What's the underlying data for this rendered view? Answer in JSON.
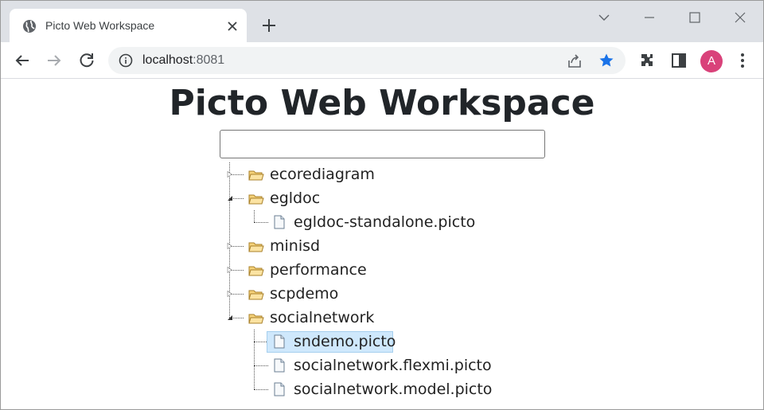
{
  "browser": {
    "tab_title": "Picto Web Workspace",
    "url_host": "localhost",
    "url_port": ":8081",
    "avatar_letter": "A"
  },
  "page": {
    "title": "Picto Web Workspace",
    "search_value": ""
  },
  "tree": [
    {
      "label": "ecorediagram",
      "kind": "folder",
      "expanded": false
    },
    {
      "label": "egldoc",
      "kind": "folder",
      "expanded": true
    },
    {
      "label": "egldoc-standalone.picto",
      "kind": "file",
      "parent": "egldoc"
    },
    {
      "label": "minisd",
      "kind": "folder",
      "expanded": false
    },
    {
      "label": "performance",
      "kind": "folder",
      "expanded": false
    },
    {
      "label": "scpdemo",
      "kind": "folder",
      "expanded": false
    },
    {
      "label": "socialnetwork",
      "kind": "folder",
      "expanded": true
    },
    {
      "label": "sndemo.picto",
      "kind": "file",
      "parent": "socialnetwork",
      "selected": true
    },
    {
      "label": "socialnetwork.flexmi.picto",
      "kind": "file",
      "parent": "socialnetwork"
    },
    {
      "label": "socialnetwork.model.picto",
      "kind": "file",
      "parent": "socialnetwork"
    }
  ],
  "colors": {
    "accent_star": "#1a73e8",
    "avatar": "#d9427a",
    "selection_bg": "#cfe8fc",
    "folder_icon": "#e8b84b"
  }
}
